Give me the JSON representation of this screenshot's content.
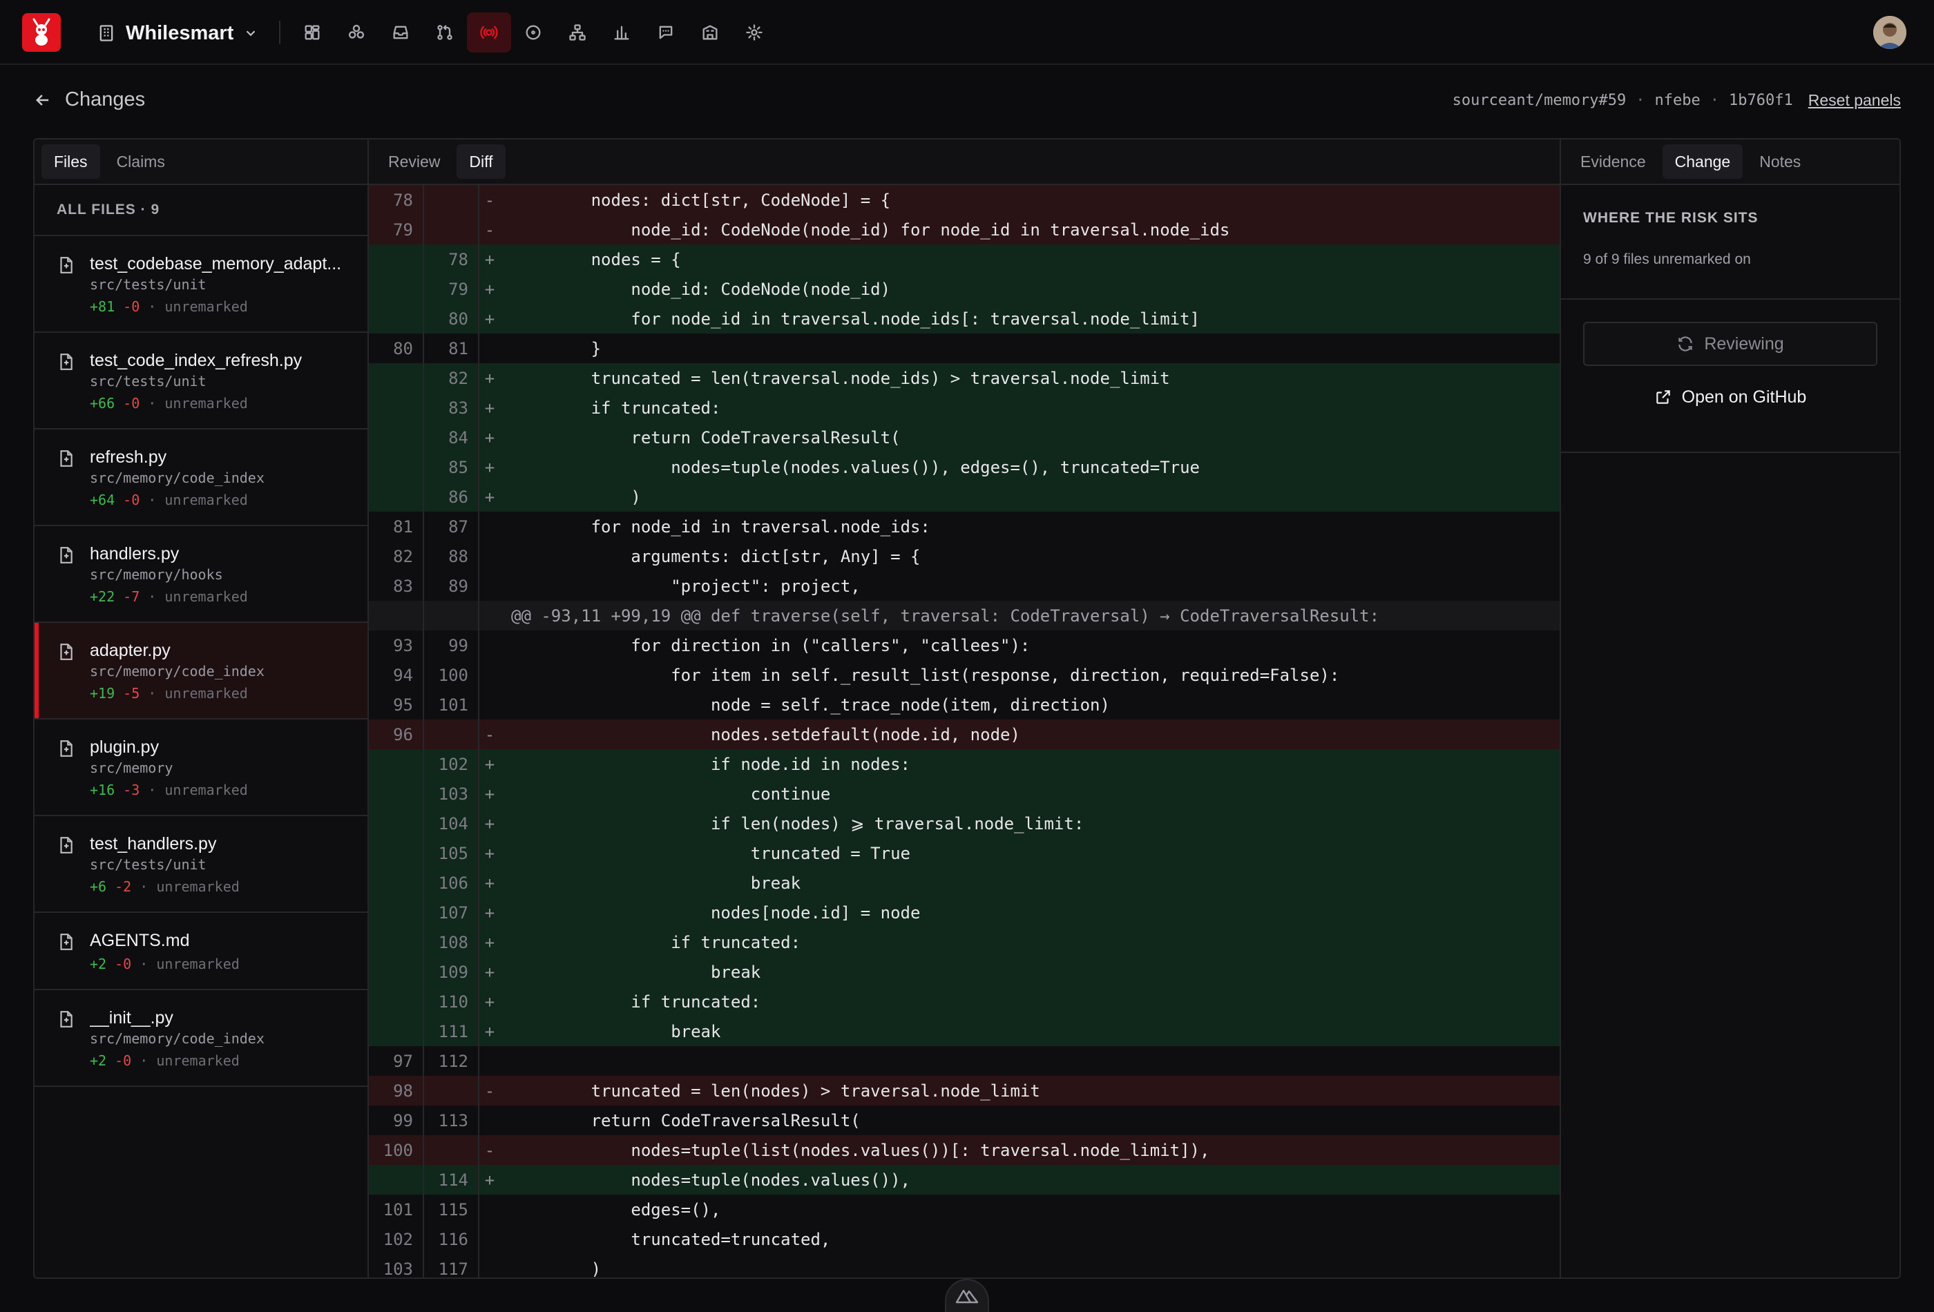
{
  "app": {
    "workspace": "Whilesmart",
    "nav_icons": [
      "dashboard-icon",
      "modules-icon",
      "inbox-icon",
      "pull-request-icon",
      "radar-icon",
      "issue-icon",
      "hierarchy-icon",
      "chart-icon",
      "chat-icon",
      "building-icon",
      "settings-icon"
    ],
    "active_nav": "radar-icon",
    "accent": "#e1141f"
  },
  "header": {
    "back_label": "Changes",
    "repo_ref": "sourceant/memory#59",
    "author": "nfebe",
    "commit": "1b760f1",
    "reset_label": "Reset panels",
    "separator": "·"
  },
  "left": {
    "tabs": [
      {
        "label": "Files"
      },
      {
        "label": "Claims"
      }
    ],
    "heading": "ALL FILES · 9",
    "files": [
      {
        "name": "test_codebase_memory_adapt...",
        "path": "src/tests/unit",
        "add": "+81",
        "del": "-0",
        "status": "unremarked"
      },
      {
        "name": "test_code_index_refresh.py",
        "path": "src/tests/unit",
        "add": "+66",
        "del": "-0",
        "status": "unremarked"
      },
      {
        "name": "refresh.py",
        "path": "src/memory/code_index",
        "add": "+64",
        "del": "-0",
        "status": "unremarked"
      },
      {
        "name": "handlers.py",
        "path": "src/memory/hooks",
        "add": "+22",
        "del": "-7",
        "status": "unremarked"
      },
      {
        "name": "adapter.py",
        "path": "src/memory/code_index",
        "add": "+19",
        "del": "-5",
        "status": "unremarked"
      },
      {
        "name": "plugin.py",
        "path": "src/memory",
        "add": "+16",
        "del": "-3",
        "status": "unremarked"
      },
      {
        "name": "test_handlers.py",
        "path": "src/tests/unit",
        "add": "+6",
        "del": "-2",
        "status": "unremarked"
      },
      {
        "name": "AGENTS.md",
        "path": "",
        "add": "+2",
        "del": "-0",
        "status": "unremarked"
      },
      {
        "name": "__init__.py",
        "path": "src/memory/code_index",
        "add": "+2",
        "del": "-0",
        "status": "unremarked"
      }
    ],
    "selected_index": 4
  },
  "middle": {
    "tabs": [
      {
        "label": "Review"
      },
      {
        "label": "Diff"
      }
    ],
    "diff": [
      {
        "t": "del",
        "o": "78",
        "n": "",
        "s": "-",
        "c": "        nodes: dict[str, CodeNode] = {"
      },
      {
        "t": "del",
        "o": "79",
        "n": "",
        "s": "-",
        "c": "            node_id: CodeNode(node_id) for node_id in traversal.node_ids"
      },
      {
        "t": "add",
        "o": "",
        "n": "78",
        "s": "+",
        "c": "        nodes = {"
      },
      {
        "t": "add",
        "o": "",
        "n": "79",
        "s": "+",
        "c": "            node_id: CodeNode(node_id)"
      },
      {
        "t": "add",
        "o": "",
        "n": "80",
        "s": "+",
        "c": "            for node_id in traversal.node_ids[: traversal.node_limit]"
      },
      {
        "t": "ctx",
        "o": "80",
        "n": "81",
        "s": "",
        "c": "        }"
      },
      {
        "t": "add",
        "o": "",
        "n": "82",
        "s": "+",
        "c": "        truncated = len(traversal.node_ids) > traversal.node_limit"
      },
      {
        "t": "add",
        "o": "",
        "n": "83",
        "s": "+",
        "c": "        if truncated:"
      },
      {
        "t": "add",
        "o": "",
        "n": "84",
        "s": "+",
        "c": "            return CodeTraversalResult("
      },
      {
        "t": "add",
        "o": "",
        "n": "85",
        "s": "+",
        "c": "                nodes=tuple(nodes.values()), edges=(), truncated=True"
      },
      {
        "t": "add",
        "o": "",
        "n": "86",
        "s": "+",
        "c": "            )"
      },
      {
        "t": "ctx",
        "o": "81",
        "n": "87",
        "s": "",
        "c": "        for node_id in traversal.node_ids:"
      },
      {
        "t": "ctx",
        "o": "82",
        "n": "88",
        "s": "",
        "c": "            arguments: dict[str, Any] = {"
      },
      {
        "t": "ctx",
        "o": "83",
        "n": "89",
        "s": "",
        "c": "                \"project\": project,"
      },
      {
        "t": "hunk",
        "o": "",
        "n": "",
        "s": "",
        "c": "@@ -93,11 +99,19 @@ def traverse(self, traversal: CodeTraversal) → CodeTraversalResult:"
      },
      {
        "t": "ctx",
        "o": "93",
        "n": "99",
        "s": "",
        "c": "            for direction in (\"callers\", \"callees\"):"
      },
      {
        "t": "ctx",
        "o": "94",
        "n": "100",
        "s": "",
        "c": "                for item in self._result_list(response, direction, required=False):"
      },
      {
        "t": "ctx",
        "o": "95",
        "n": "101",
        "s": "",
        "c": "                    node = self._trace_node(item, direction)"
      },
      {
        "t": "del",
        "o": "96",
        "n": "",
        "s": "-",
        "c": "                    nodes.setdefault(node.id, node)"
      },
      {
        "t": "add",
        "o": "",
        "n": "102",
        "s": "+",
        "c": "                    if node.id in nodes:"
      },
      {
        "t": "add",
        "o": "",
        "n": "103",
        "s": "+",
        "c": "                        continue"
      },
      {
        "t": "add",
        "o": "",
        "n": "104",
        "s": "+",
        "c": "                    if len(nodes) ⩾ traversal.node_limit:"
      },
      {
        "t": "add",
        "o": "",
        "n": "105",
        "s": "+",
        "c": "                        truncated = True"
      },
      {
        "t": "add",
        "o": "",
        "n": "106",
        "s": "+",
        "c": "                        break"
      },
      {
        "t": "add",
        "o": "",
        "n": "107",
        "s": "+",
        "c": "                    nodes[node.id] = node"
      },
      {
        "t": "add",
        "o": "",
        "n": "108",
        "s": "+",
        "c": "                if truncated:"
      },
      {
        "t": "add",
        "o": "",
        "n": "109",
        "s": "+",
        "c": "                    break"
      },
      {
        "t": "add",
        "o": "",
        "n": "110",
        "s": "+",
        "c": "            if truncated:"
      },
      {
        "t": "add",
        "o": "",
        "n": "111",
        "s": "+",
        "c": "                break"
      },
      {
        "t": "ctx",
        "o": "97",
        "n": "112",
        "s": "",
        "c": ""
      },
      {
        "t": "del",
        "o": "98",
        "n": "",
        "s": "-",
        "c": "        truncated = len(nodes) > traversal.node_limit"
      },
      {
        "t": "ctx",
        "o": "99",
        "n": "113",
        "s": "",
        "c": "        return CodeTraversalResult("
      },
      {
        "t": "del",
        "o": "100",
        "n": "",
        "s": "-",
        "c": "            nodes=tuple(list(nodes.values())[: traversal.node_limit]),"
      },
      {
        "t": "add",
        "o": "",
        "n": "114",
        "s": "+",
        "c": "            nodes=tuple(nodes.values()),"
      },
      {
        "t": "ctx",
        "o": "101",
        "n": "115",
        "s": "",
        "c": "            edges=(),"
      },
      {
        "t": "ctx",
        "o": "102",
        "n": "116",
        "s": "",
        "c": "            truncated=truncated,"
      },
      {
        "t": "ctx",
        "o": "103",
        "n": "117",
        "s": "",
        "c": "        )"
      }
    ]
  },
  "right": {
    "tabs": [
      {
        "label": "Evidence"
      },
      {
        "label": "Change"
      },
      {
        "label": "Notes"
      }
    ],
    "risk_title": "WHERE THE RISK SITS",
    "risk_text": "9 of 9 files unremarked on",
    "reviewing_label": "Reviewing",
    "github_label": "Open on GitHub"
  }
}
